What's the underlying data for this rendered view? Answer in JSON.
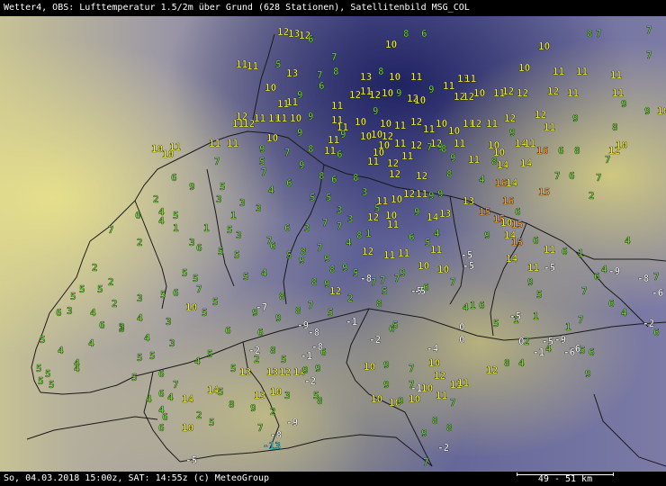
{
  "title": "Wetter4, OBS: Lufttemperatur 1.5/2m über Grund (628 Stationen), Satellitenbild MSG_COL",
  "footer": {
    "left": "So, 04.03.2018 15:00z, SAT: 14:55z (c) MeteoGroup",
    "scale": "49 - 51 km"
  },
  "colors": {
    "white": "#ffffff",
    "green": "#6fd13a",
    "lightgreen": "#b8e04a",
    "yellow": "#f2f23a",
    "orange": "#f7a23a",
    "cyan": "#3ad0e8",
    "border": "#202020"
  },
  "legend_levels": [
    "-9",
    "-8",
    "-5",
    "-4",
    "-2",
    "-1",
    "0",
    "1",
    "2",
    "3",
    "4",
    "5",
    "6",
    "7",
    "8",
    "9",
    "10",
    "11",
    "12",
    "13",
    "14",
    "15",
    "16"
  ],
  "stations": [
    [
      "12",
      308,
      28
    ],
    [
      "13",
      320,
      30
    ],
    [
      "12",
      332,
      32
    ],
    [
      "6",
      342,
      36
    ],
    [
      "10",
      428,
      42
    ],
    [
      "8",
      448,
      30
    ],
    [
      "6",
      468,
      30
    ],
    [
      "10",
      598,
      44
    ],
    [
      "8",
      652,
      30
    ],
    [
      "7",
      662,
      30
    ],
    [
      "7",
      718,
      26
    ],
    [
      "11",
      262,
      64
    ],
    [
      "11",
      274,
      66
    ],
    [
      "13",
      318,
      74
    ],
    [
      "5",
      306,
      64
    ],
    [
      "7",
      352,
      76
    ],
    [
      "7",
      368,
      56
    ],
    [
      "8",
      370,
      72
    ],
    [
      "13",
      400,
      78
    ],
    [
      "8",
      420,
      72
    ],
    [
      "10",
      432,
      78
    ],
    [
      "11",
      456,
      78
    ],
    [
      "13",
      508,
      80
    ],
    [
      "11",
      516,
      80
    ],
    [
      "10",
      576,
      68
    ],
    [
      "11",
      614,
      72
    ],
    [
      "11",
      640,
      72
    ],
    [
      "11",
      678,
      76
    ],
    [
      "7",
      718,
      54
    ],
    [
      "10",
      294,
      90
    ],
    [
      "11",
      308,
      108
    ],
    [
      "11",
      318,
      106
    ],
    [
      "9",
      330,
      98
    ],
    [
      "6",
      354,
      88
    ],
    [
      "11",
      368,
      110
    ],
    [
      "12",
      388,
      98
    ],
    [
      "11",
      400,
      94
    ],
    [
      "12",
      410,
      98
    ],
    [
      "10",
      424,
      96
    ],
    [
      "9",
      440,
      96
    ],
    [
      "12",
      452,
      102
    ],
    [
      "10",
      460,
      104
    ],
    [
      "9",
      476,
      92
    ],
    [
      "11",
      492,
      88
    ],
    [
      "12",
      504,
      100
    ],
    [
      "12",
      514,
      100
    ],
    [
      "10",
      526,
      96
    ],
    [
      "11",
      548,
      96
    ],
    [
      "12",
      558,
      94
    ],
    [
      "12",
      574,
      96
    ],
    [
      "12",
      608,
      94
    ],
    [
      "11",
      630,
      96
    ],
    [
      "11",
      680,
      96
    ],
    [
      "9",
      690,
      108
    ],
    [
      "9",
      716,
      116
    ],
    [
      "10",
      730,
      116
    ],
    [
      "12",
      262,
      122
    ],
    [
      "11",
      258,
      130
    ],
    [
      "12",
      270,
      130
    ],
    [
      "11",
      282,
      124
    ],
    [
      "11",
      298,
      124
    ],
    [
      "11",
      306,
      124
    ],
    [
      "10",
      322,
      124
    ],
    [
      "9",
      342,
      122
    ],
    [
      "11",
      368,
      126
    ],
    [
      "11",
      374,
      134
    ],
    [
      "10",
      394,
      128
    ],
    [
      "9",
      414,
      116
    ],
    [
      "10",
      422,
      130
    ],
    [
      "11",
      438,
      132
    ],
    [
      "12",
      456,
      128
    ],
    [
      "11",
      470,
      136
    ],
    [
      "10",
      484,
      130
    ],
    [
      "10",
      498,
      138
    ],
    [
      "11",
      514,
      130
    ],
    [
      "12",
      522,
      130
    ],
    [
      "11",
      540,
      130
    ],
    [
      "12",
      560,
      124
    ],
    [
      "12",
      594,
      120
    ],
    [
      "11",
      604,
      134
    ],
    [
      "9",
      636,
      124
    ],
    [
      "8",
      680,
      134
    ],
    [
      "11",
      232,
      152
    ],
    [
      "11",
      252,
      152
    ],
    [
      "10",
      296,
      146
    ],
    [
      "9",
      330,
      140
    ],
    [
      "11",
      364,
      148
    ],
    [
      "9",
      378,
      142
    ],
    [
      "10",
      400,
      144
    ],
    [
      "10",
      412,
      142
    ],
    [
      "12",
      424,
      144
    ],
    [
      "11",
      438,
      152
    ],
    [
      "12",
      456,
      154
    ],
    [
      "12",
      478,
      152
    ],
    [
      "9",
      486,
      156
    ],
    [
      "11",
      504,
      152
    ],
    [
      "10",
      542,
      154
    ],
    [
      "10",
      548,
      162
    ],
    [
      "9",
      566,
      140
    ],
    [
      "14",
      572,
      152
    ],
    [
      "11",
      582,
      152
    ],
    [
      "16",
      596,
      160
    ],
    [
      "6",
      620,
      160
    ],
    [
      "8",
      638,
      160
    ],
    [
      "12",
      676,
      160
    ],
    [
      "10",
      684,
      154
    ],
    [
      "10",
      168,
      158
    ],
    [
      "10",
      180,
      164
    ],
    [
      "11",
      188,
      156
    ],
    [
      "9",
      288,
      158
    ],
    [
      "7",
      316,
      162
    ],
    [
      "8",
      342,
      158
    ],
    [
      "11",
      360,
      160
    ],
    [
      "6",
      374,
      164
    ],
    [
      "10",
      420,
      154
    ],
    [
      "10",
      414,
      162
    ],
    [
      "11",
      408,
      172
    ],
    [
      "12",
      430,
      174
    ],
    [
      "11",
      446,
      166
    ],
    [
      "7",
      474,
      156
    ],
    [
      "8",
      490,
      158
    ],
    [
      "9",
      500,
      168
    ],
    [
      "11",
      520,
      170
    ],
    [
      "8",
      546,
      172
    ],
    [
      "14",
      552,
      176
    ],
    [
      "14",
      578,
      174
    ],
    [
      "7",
      672,
      170
    ],
    [
      "7",
      238,
      172
    ],
    [
      "5",
      288,
      172
    ],
    [
      "9",
      332,
      176
    ],
    [
      "8",
      354,
      188
    ],
    [
      "6",
      368,
      192
    ],
    [
      "8",
      392,
      190
    ],
    [
      "12",
      432,
      186
    ],
    [
      "12",
      462,
      188
    ],
    [
      "8",
      496,
      186
    ],
    [
      "4",
      532,
      192
    ],
    [
      "16",
      550,
      196
    ],
    [
      "14",
      562,
      196
    ],
    [
      "7",
      616,
      188
    ],
    [
      "6",
      632,
      188
    ],
    [
      "7",
      662,
      190
    ],
    [
      "6",
      190,
      190
    ],
    [
      "9",
      210,
      200
    ],
    [
      "5",
      244,
      200
    ],
    [
      "7",
      290,
      184
    ],
    [
      "4",
      298,
      204
    ],
    [
      "6",
      318,
      196
    ],
    [
      "5",
      344,
      212
    ],
    [
      "5",
      362,
      212
    ],
    [
      "3",
      402,
      206
    ],
    [
      "11",
      418,
      216
    ],
    [
      "10",
      434,
      214
    ],
    [
      "12",
      448,
      208
    ],
    [
      "11",
      462,
      208
    ],
    [
      "9",
      476,
      210
    ],
    [
      "9",
      486,
      208
    ],
    [
      "13",
      514,
      216
    ],
    [
      "15",
      598,
      206
    ],
    [
      "16",
      558,
      216
    ],
    [
      "2",
      654,
      210
    ],
    [
      "2",
      170,
      214
    ],
    [
      "4",
      176,
      228
    ],
    [
      "5",
      192,
      232
    ],
    [
      "3",
      240,
      214
    ],
    [
      "3",
      266,
      218
    ],
    [
      "3",
      284,
      224
    ],
    [
      "1",
      256,
      232
    ],
    [
      "3",
      374,
      226
    ],
    [
      "3",
      386,
      236
    ],
    [
      "5",
      416,
      224
    ],
    [
      "12",
      408,
      234
    ],
    [
      "10",
      428,
      232
    ],
    [
      "11",
      430,
      242
    ],
    [
      "9",
      460,
      228
    ],
    [
      "14",
      474,
      234
    ],
    [
      "13",
      488,
      230
    ],
    [
      "15",
      532,
      228
    ],
    [
      "15",
      548,
      236
    ],
    [
      "10",
      556,
      240
    ],
    [
      "15",
      568,
      242
    ],
    [
      "6",
      572,
      228
    ],
    [
      "7",
      120,
      248
    ],
    [
      "6",
      150,
      232
    ],
    [
      "4",
      176,
      238
    ],
    [
      "1",
      192,
      246
    ],
    [
      "1",
      226,
      246
    ],
    [
      "5",
      252,
      248
    ],
    [
      "3",
      262,
      254
    ],
    [
      "7",
      296,
      260
    ],
    [
      "6",
      316,
      246
    ],
    [
      "3",
      338,
      246
    ],
    [
      "7",
      358,
      240
    ],
    [
      "7",
      374,
      244
    ],
    [
      "8",
      396,
      254
    ],
    [
      "1",
      406,
      252
    ],
    [
      "6",
      454,
      256
    ],
    [
      "5",
      472,
      262
    ],
    [
      "11",
      478,
      270
    ],
    [
      "4",
      482,
      252
    ],
    [
      "-5",
      512,
      276
    ],
    [
      "9",
      538,
      254
    ],
    [
      "14",
      560,
      254
    ],
    [
      "15",
      568,
      262
    ],
    [
      "6",
      592,
      260
    ],
    [
      "11",
      604,
      270
    ],
    [
      "4",
      694,
      260
    ],
    [
      "2",
      152,
      262
    ],
    [
      "3",
      210,
      262
    ],
    [
      "6",
      218,
      268
    ],
    [
      "5",
      242,
      272
    ],
    [
      "5",
      260,
      276
    ],
    [
      "6",
      300,
      266
    ],
    [
      "5",
      318,
      276
    ],
    [
      "8",
      334,
      272
    ],
    [
      "7",
      352,
      268
    ],
    [
      "4",
      384,
      262
    ],
    [
      "12",
      402,
      272
    ],
    [
      "11",
      426,
      276
    ],
    [
      "11",
      442,
      274
    ],
    [
      "-5",
      514,
      288
    ],
    [
      "10",
      464,
      288
    ],
    [
      "10",
      486,
      292
    ],
    [
      "14",
      562,
      280
    ],
    [
      "-5",
      604,
      290
    ],
    [
      "6",
      624,
      272
    ],
    [
      "1",
      642,
      274
    ],
    [
      "4",
      668,
      292
    ],
    [
      "-9",
      676,
      294
    ],
    [
      "-8",
      708,
      302
    ],
    [
      "7",
      726,
      300
    ],
    [
      "2",
      102,
      290
    ],
    [
      "2",
      120,
      306
    ],
    [
      "5",
      202,
      296
    ],
    [
      "5",
      214,
      302
    ],
    [
      "5",
      270,
      300
    ],
    [
      "4",
      290,
      296
    ],
    [
      "9",
      332,
      282
    ],
    [
      "9",
      360,
      280
    ],
    [
      "8",
      366,
      292
    ],
    [
      "9",
      380,
      290
    ],
    [
      "5",
      392,
      296
    ],
    [
      "7",
      412,
      306
    ],
    [
      "7",
      438,
      302
    ],
    [
      "9",
      444,
      296
    ],
    [
      "-8",
      400,
      302
    ],
    [
      "-5",
      456,
      316
    ],
    [
      "-5",
      460,
      316
    ],
    [
      "11",
      586,
      290
    ],
    [
      "6",
      660,
      300
    ],
    [
      "-6",
      724,
      318
    ],
    [
      "5",
      78,
      322
    ],
    [
      "5",
      88,
      314
    ],
    [
      "5",
      108,
      314
    ],
    [
      "2",
      124,
      330
    ],
    [
      "3",
      152,
      324
    ],
    [
      "5",
      178,
      320
    ],
    [
      "6",
      192,
      318
    ],
    [
      "7",
      218,
      314
    ],
    [
      "5",
      236,
      328
    ],
    [
      "-7",
      284,
      334
    ],
    [
      "8",
      310,
      322
    ],
    [
      "8",
      346,
      306
    ],
    [
      "9",
      360,
      308
    ],
    [
      "12",
      366,
      316
    ],
    [
      "2",
      386,
      324
    ],
    [
      "7",
      422,
      304
    ],
    [
      "5",
      424,
      316
    ],
    [
      "6",
      470,
      312
    ],
    [
      "7",
      500,
      306
    ],
    [
      "6",
      532,
      332
    ],
    [
      "9",
      586,
      306
    ],
    [
      "5",
      596,
      320
    ],
    [
      "7",
      646,
      316
    ],
    [
      "6",
      676,
      330
    ],
    [
      "4",
      690,
      340
    ],
    [
      "-2",
      714,
      352
    ],
    [
      "6",
      62,
      340
    ],
    [
      "3",
      74,
      338
    ],
    [
      "4",
      100,
      340
    ],
    [
      "6",
      110,
      354
    ],
    [
      "3",
      132,
      356
    ],
    [
      "4",
      152,
      346
    ],
    [
      "3",
      184,
      350
    ],
    [
      "10",
      206,
      334
    ],
    [
      "5",
      224,
      340
    ],
    [
      "9",
      280,
      340
    ],
    [
      "8",
      328,
      338
    ],
    [
      "7",
      342,
      332
    ],
    [
      "5",
      364,
      340
    ],
    [
      "8",
      418,
      330
    ],
    [
      "4",
      514,
      334
    ],
    [
      "1",
      522,
      332
    ],
    [
      "1",
      570,
      348
    ],
    [
      "-5",
      566,
      344
    ],
    [
      "1",
      592,
      344
    ],
    [
      "7",
      642,
      348
    ],
    [
      "1",
      628,
      356
    ],
    [
      "6",
      726,
      362
    ],
    [
      "5",
      44,
      370
    ],
    [
      "4",
      64,
      382
    ],
    [
      "4",
      98,
      374
    ],
    [
      "3",
      132,
      358
    ],
    [
      "4",
      160,
      368
    ],
    [
      "3",
      188,
      374
    ],
    [
      "6",
      250,
      360
    ],
    [
      "6",
      286,
      362
    ],
    [
      "9",
      306,
      346
    ],
    [
      "-9",
      330,
      354
    ],
    [
      "-8",
      342,
      362
    ],
    [
      "-1",
      384,
      350
    ],
    [
      "6",
      432,
      358
    ],
    [
      "5",
      436,
      354
    ],
    [
      "-2",
      410,
      370
    ],
    [
      "0",
      510,
      356
    ],
    [
      "0",
      510,
      370
    ],
    [
      "5",
      548,
      352
    ],
    [
      "2",
      582,
      372
    ],
    [
      "-5",
      602,
      372
    ],
    [
      "-9",
      616,
      370
    ],
    [
      "-6",
      632,
      380
    ],
    [
      "4",
      606,
      380
    ],
    [
      "5",
      644,
      382
    ],
    [
      "5",
      40,
      402
    ],
    [
      "5",
      50,
      408
    ],
    [
      "4",
      82,
      396
    ],
    [
      "5",
      152,
      390
    ],
    [
      "5",
      166,
      388
    ],
    [
      "4",
      216,
      394
    ],
    [
      "5",
      230,
      386
    ],
    [
      "-2",
      276,
      382
    ],
    [
      "2",
      282,
      392
    ],
    [
      "8",
      300,
      382
    ],
    [
      "5",
      312,
      392
    ],
    [
      "-1",
      334,
      388
    ],
    [
      "-8",
      346,
      378
    ],
    [
      "6",
      356,
      384
    ],
    [
      "-4",
      474,
      380
    ],
    [
      "-1",
      592,
      384
    ],
    [
      "0",
      576,
      372
    ],
    [
      "-6",
      626,
      384
    ],
    [
      "6",
      654,
      384
    ],
    [
      "5",
      42,
      416
    ],
    [
      "5",
      54,
      420
    ],
    [
      "4",
      82,
      402
    ],
    [
      "5",
      146,
      412
    ],
    [
      "6",
      176,
      408
    ],
    [
      "7",
      192,
      420
    ],
    [
      "5",
      256,
      402
    ],
    [
      "13",
      266,
      406
    ],
    [
      "13",
      296,
      406
    ],
    [
      "12",
      310,
      406
    ],
    [
      "14",
      326,
      406
    ],
    [
      "9",
      336,
      404
    ],
    [
      "-2",
      338,
      416
    ],
    [
      "9",
      350,
      402
    ],
    [
      "10",
      404,
      400
    ],
    [
      "9",
      426,
      398
    ],
    [
      "7",
      454,
      402
    ],
    [
      "10",
      476,
      396
    ],
    [
      "12",
      482,
      410
    ],
    [
      "12",
      540,
      404
    ],
    [
      "8",
      560,
      396
    ],
    [
      "4",
      576,
      396
    ],
    [
      "9",
      650,
      408
    ],
    [
      "4",
      162,
      436
    ],
    [
      "6",
      176,
      430
    ],
    [
      "4",
      186,
      434
    ],
    [
      "14",
      202,
      436
    ],
    [
      "14",
      230,
      426
    ],
    [
      "5",
      242,
      428
    ],
    [
      "13",
      282,
      432
    ],
    [
      "10",
      300,
      428
    ],
    [
      "3",
      316,
      432
    ],
    [
      "5",
      348,
      432
    ],
    [
      "11",
      500,
      420
    ],
    [
      "11",
      508,
      418
    ],
    [
      "9",
      426,
      420
    ],
    [
      "7",
      454,
      420
    ],
    [
      "10",
      468,
      424
    ],
    [
      "4",
      176,
      448
    ],
    [
      "6",
      180,
      456
    ],
    [
      "2",
      218,
      454
    ],
    [
      "8",
      254,
      442
    ],
    [
      "9",
      278,
      446
    ],
    [
      "2",
      300,
      450
    ],
    [
      "8",
      352,
      438
    ],
    [
      "-1",
      456,
      424
    ],
    [
      "10",
      412,
      436
    ],
    [
      "10",
      432,
      440
    ],
    [
      "9",
      442,
      438
    ],
    [
      "10",
      454,
      436
    ],
    [
      "11",
      484,
      432
    ],
    [
      "7",
      500,
      440
    ],
    [
      "6",
      176,
      468
    ],
    [
      "10",
      202,
      468
    ],
    [
      "5",
      232,
      462
    ],
    [
      "7",
      286,
      468
    ],
    [
      "-8",
      300,
      476
    ],
    [
      "-9",
      318,
      462
    ],
    [
      "9",
      468,
      474
    ],
    [
      "8",
      480,
      460
    ],
    [
      "8",
      496,
      468
    ],
    [
      "-2",
      486,
      490
    ],
    [
      "7",
      470,
      506
    ],
    [
      "-5",
      206,
      504
    ],
    [
      "-13",
      292,
      488
    ]
  ]
}
